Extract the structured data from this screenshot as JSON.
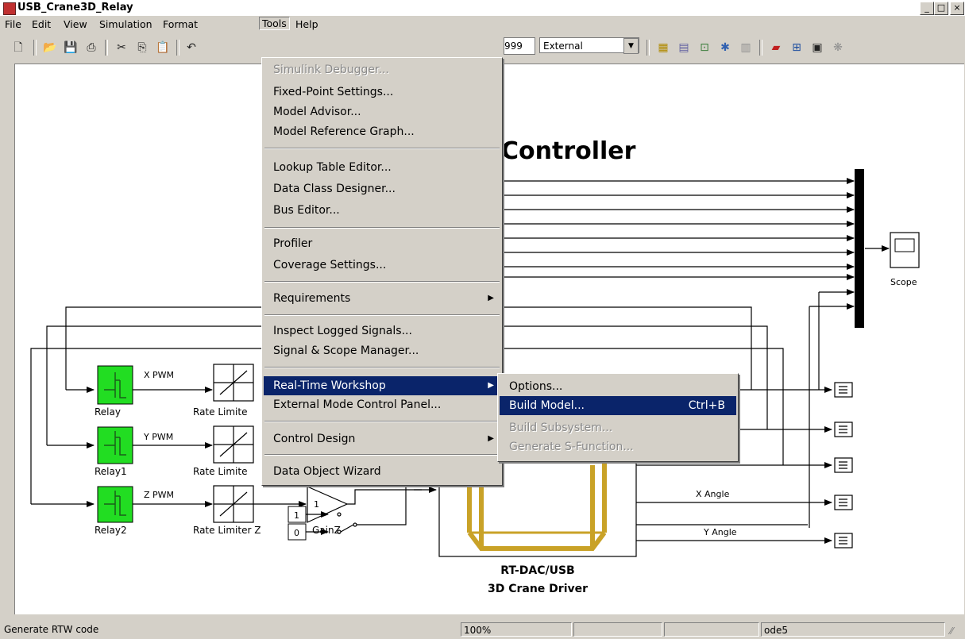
{
  "window": {
    "title": "USB_Crane3D_Relay",
    "min": "_",
    "max": "□",
    "close": "×"
  },
  "menubar": [
    "File",
    "Edit",
    "View",
    "Simulation",
    "Format",
    "Tools",
    "Help"
  ],
  "toolbar": {
    "stop_time": "999",
    "mode": "External"
  },
  "tools_menu": {
    "groups": [
      [
        {
          "label": "Simulink Debugger...",
          "disabled": true
        },
        {
          "label": "Fixed-Point Settings..."
        },
        {
          "label": "Model Advisor..."
        },
        {
          "label": "Model Reference Graph..."
        }
      ],
      [
        {
          "label": "Lookup Table Editor..."
        },
        {
          "label": "Data Class Designer..."
        },
        {
          "label": "Bus Editor..."
        }
      ],
      [
        {
          "label": "Profiler"
        },
        {
          "label": "Coverage Settings..."
        }
      ],
      [
        {
          "label": "Requirements",
          "submenu": true
        }
      ],
      [
        {
          "label": "Inspect Logged Signals..."
        },
        {
          "label": "Signal & Scope Manager..."
        }
      ],
      [
        {
          "label": "Real-Time Workshop",
          "submenu": true,
          "highlighted": true
        },
        {
          "label": "External Mode Control Panel..."
        }
      ],
      [
        {
          "label": "Control Design",
          "submenu": true
        }
      ],
      [
        {
          "label": "Data Object Wizard"
        }
      ]
    ]
  },
  "rtw_submenu": [
    {
      "label": "Options..."
    },
    {
      "label": "Build Model...",
      "shortcut": "Ctrl+B",
      "highlighted": true
    },
    {
      "label": "Build Subsystem...",
      "disabled": true
    },
    {
      "label": "Generate S-Function...",
      "disabled": true
    }
  ],
  "diagram": {
    "heading": "Controller",
    "relays": [
      "Relay",
      "Relay1",
      "Relay2"
    ],
    "pwm_labels": [
      "X PWM",
      "Y PWM",
      "Z PWM"
    ],
    "rate_limiters": [
      "Rate Limite",
      "Rate Limite",
      "Rate Limiter Z"
    ],
    "gain_value": "1",
    "gain_label": "GainZ",
    "constants": [
      "1",
      "0"
    ],
    "driver_label_1": "RT-DAC/USB",
    "driver_label_2": "3D Crane Driver",
    "scope_label": "Scope",
    "angle_labels": [
      "X Angle",
      "Y Angle"
    ]
  },
  "status": {
    "message": "Generate RTW code",
    "zoom": "100%",
    "solver": "ode5"
  }
}
